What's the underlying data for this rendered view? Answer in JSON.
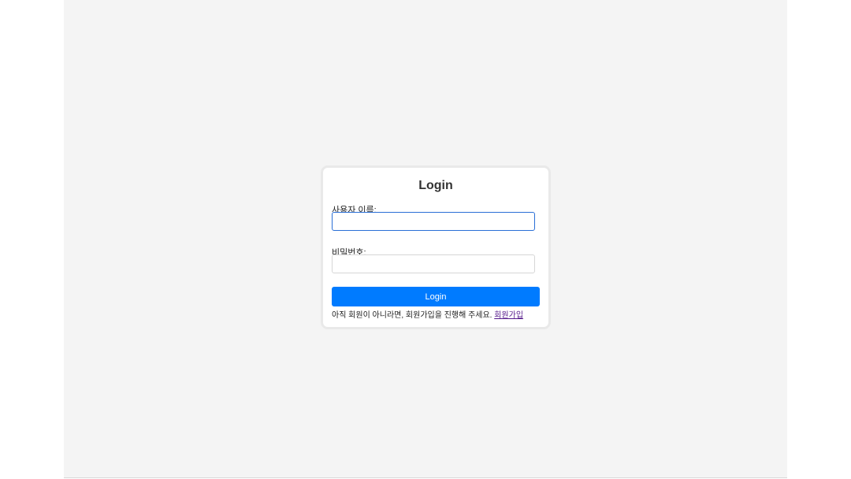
{
  "login": {
    "title": "Login",
    "username_label": "사용자 이름:",
    "username_value": "",
    "password_label": "비밀번호:",
    "password_value": "",
    "submit_label": "Login",
    "signup_prompt": "아직 회원이 아니라면, 회원가입을 진행해 주세요.",
    "signup_link": "회원가입"
  },
  "colors": {
    "accent": "#007bff",
    "background": "#f4f4f4"
  }
}
